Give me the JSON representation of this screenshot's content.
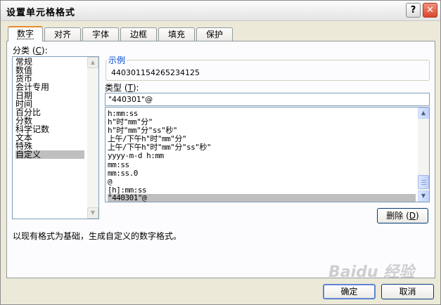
{
  "window": {
    "title": "设置单元格格式",
    "help_label": "?",
    "close_label": "✕"
  },
  "tabs": [
    {
      "label": "数字",
      "active": true
    },
    {
      "label": "对齐"
    },
    {
      "label": "字体"
    },
    {
      "label": "边框"
    },
    {
      "label": "填充"
    },
    {
      "label": "保护"
    }
  ],
  "category": {
    "label_pre": "分类 (",
    "label_key": "C",
    "label_post": "):",
    "items": [
      "常规",
      "数值",
      "货币",
      "会计专用",
      "日期",
      "时间",
      "百分比",
      "分数",
      "科学记数",
      "文本",
      "特殊",
      "自定义"
    ],
    "selected": "自定义"
  },
  "sample": {
    "label": "示例",
    "value": "440301154265234125"
  },
  "type": {
    "label_pre": "类型 (",
    "label_key": "T",
    "label_post": "):",
    "value": "\"440301\"@"
  },
  "formats": {
    "items": [
      "h:mm:ss",
      "h\"时\"mm\"分\"",
      "h\"时\"mm\"分\"ss\"秒\"",
      "上午/下午h\"时\"mm\"分\"",
      "上午/下午h\"时\"mm\"分\"ss\"秒\"",
      "yyyy-m-d h:mm",
      "mm:ss",
      "mm:ss.0",
      "@",
      "[h]:mm:ss",
      "\"440301\"@"
    ],
    "selected": "\"440301\"@"
  },
  "delete_button": {
    "label_pre": "删除 (",
    "label_key": "D",
    "label_post": ")"
  },
  "description": "以现有格式为基础，生成自定义的数字格式。",
  "footer": {
    "ok_label": "确定",
    "cancel_label": "取消"
  },
  "watermark": "Baidu 经验",
  "colors": {
    "tab_accent": "#e68b2c",
    "sample_label": "#0046d5",
    "selection": "#bfbfbf",
    "close_red": "#d9462c"
  }
}
